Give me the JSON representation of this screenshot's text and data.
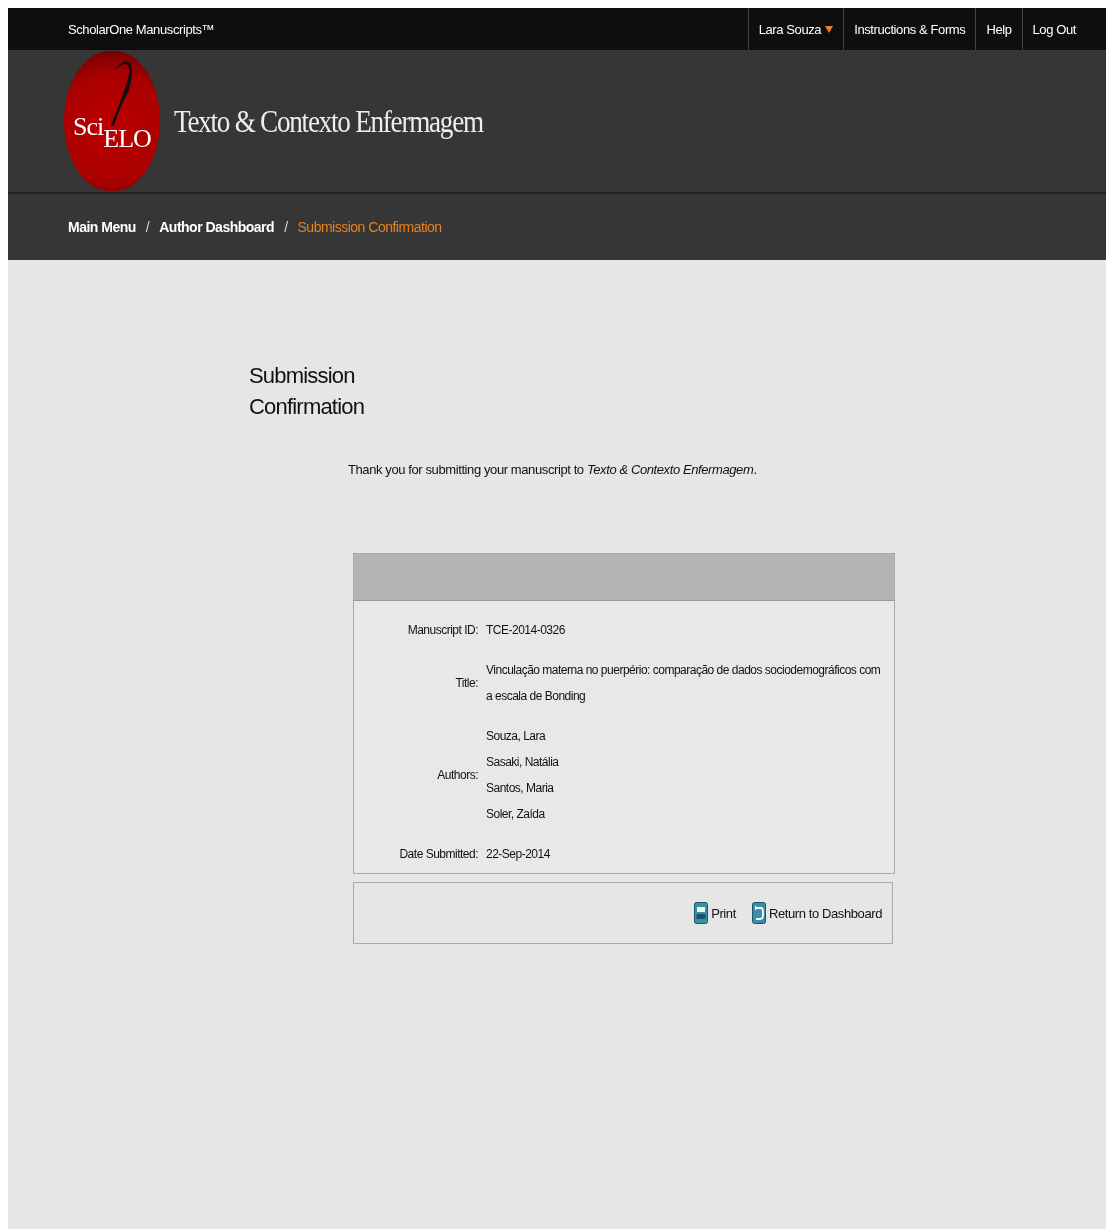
{
  "top_bar": {
    "brand": "ScholarOne Manuscripts™",
    "user": "Lara Souza",
    "links": [
      "Instructions & Forms",
      "Help",
      "Log Out"
    ]
  },
  "header": {
    "logo_text_1": "Sci",
    "logo_text_2": "ELO",
    "journal": "Texto & Contexto Enfermagem"
  },
  "breadcrumb_separator": "/",
  "breadcrumb": [
    {
      "label": "Main Menu",
      "selected": false
    },
    {
      "label": "Author Dashboard",
      "selected": false
    },
    {
      "label": "Submission Confirmation",
      "selected": true
    }
  ],
  "heading": "Submission Confirmation",
  "message": "Thank you for submitting your manuscript to *Texto & Contexto Enfermagem*.",
  "details": [
    {
      "label": "Manuscript ID:",
      "values": [
        "TCE-2014-0326"
      ]
    },
    {
      "label": "Title:",
      "values": [
        "Vinculação materna no puerpério: comparação de dados sociodemográficos com a escala de Bonding"
      ]
    },
    {
      "label": "Authors:",
      "values": [
        "Souza, Lara",
        "Sasaki, Natália",
        "Santos, Maria",
        "Soler, Zaída"
      ]
    },
    {
      "label": "Date Submitted:",
      "values": [
        "22-Sep-2014"
      ]
    }
  ],
  "actions": [
    {
      "kind": "print",
      "label": "Print"
    },
    {
      "kind": "return",
      "label": "Return to Dashboard"
    }
  ]
}
